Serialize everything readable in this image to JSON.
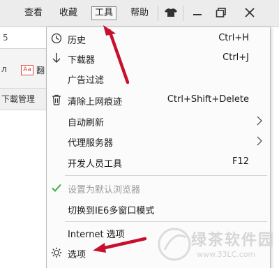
{
  "menubar": {
    "items": [
      {
        "label": "查看"
      },
      {
        "label": "收藏"
      },
      {
        "label": "工具"
      },
      {
        "label": "帮助"
      }
    ]
  },
  "background": {
    "url_fragment": "5",
    "fav_letter": "л",
    "fav_badge": "Aa",
    "fav_text": "翻",
    "download_manager": "下載管理"
  },
  "tools_menu": {
    "items": [
      {
        "label": "历史",
        "shortcut": "Ctrl+H",
        "icon": "clock-icon"
      },
      {
        "label": "下载器",
        "shortcut": "Ctrl+J",
        "icon": "download-arrow-icon"
      },
      {
        "label": "广告过滤",
        "shortcut": ""
      },
      {
        "label": "清除上网痕迹",
        "shortcut": "Ctrl+Shift+Delete",
        "icon": "trash-icon"
      },
      {
        "label": "自动刷新",
        "submenu": true
      },
      {
        "label": "代理服务器",
        "submenu": true
      },
      {
        "label": "开发人员工具",
        "shortcut": "F12"
      },
      {
        "label": "设置为默认浏览器",
        "disabled": true,
        "icon": "checkmark-icon"
      },
      {
        "label": "切换到IE6多窗口模式"
      },
      {
        "label": "Internet 选项"
      },
      {
        "label": "选项",
        "icon": "gear-icon"
      }
    ]
  },
  "watermark": {
    "text": "绿茶软件园",
    "url": "www.33LC.com"
  },
  "colors": {
    "annotation_arrow": "#c8102e",
    "check_green": "#3cb043",
    "menubar_bg": "#ececec"
  }
}
